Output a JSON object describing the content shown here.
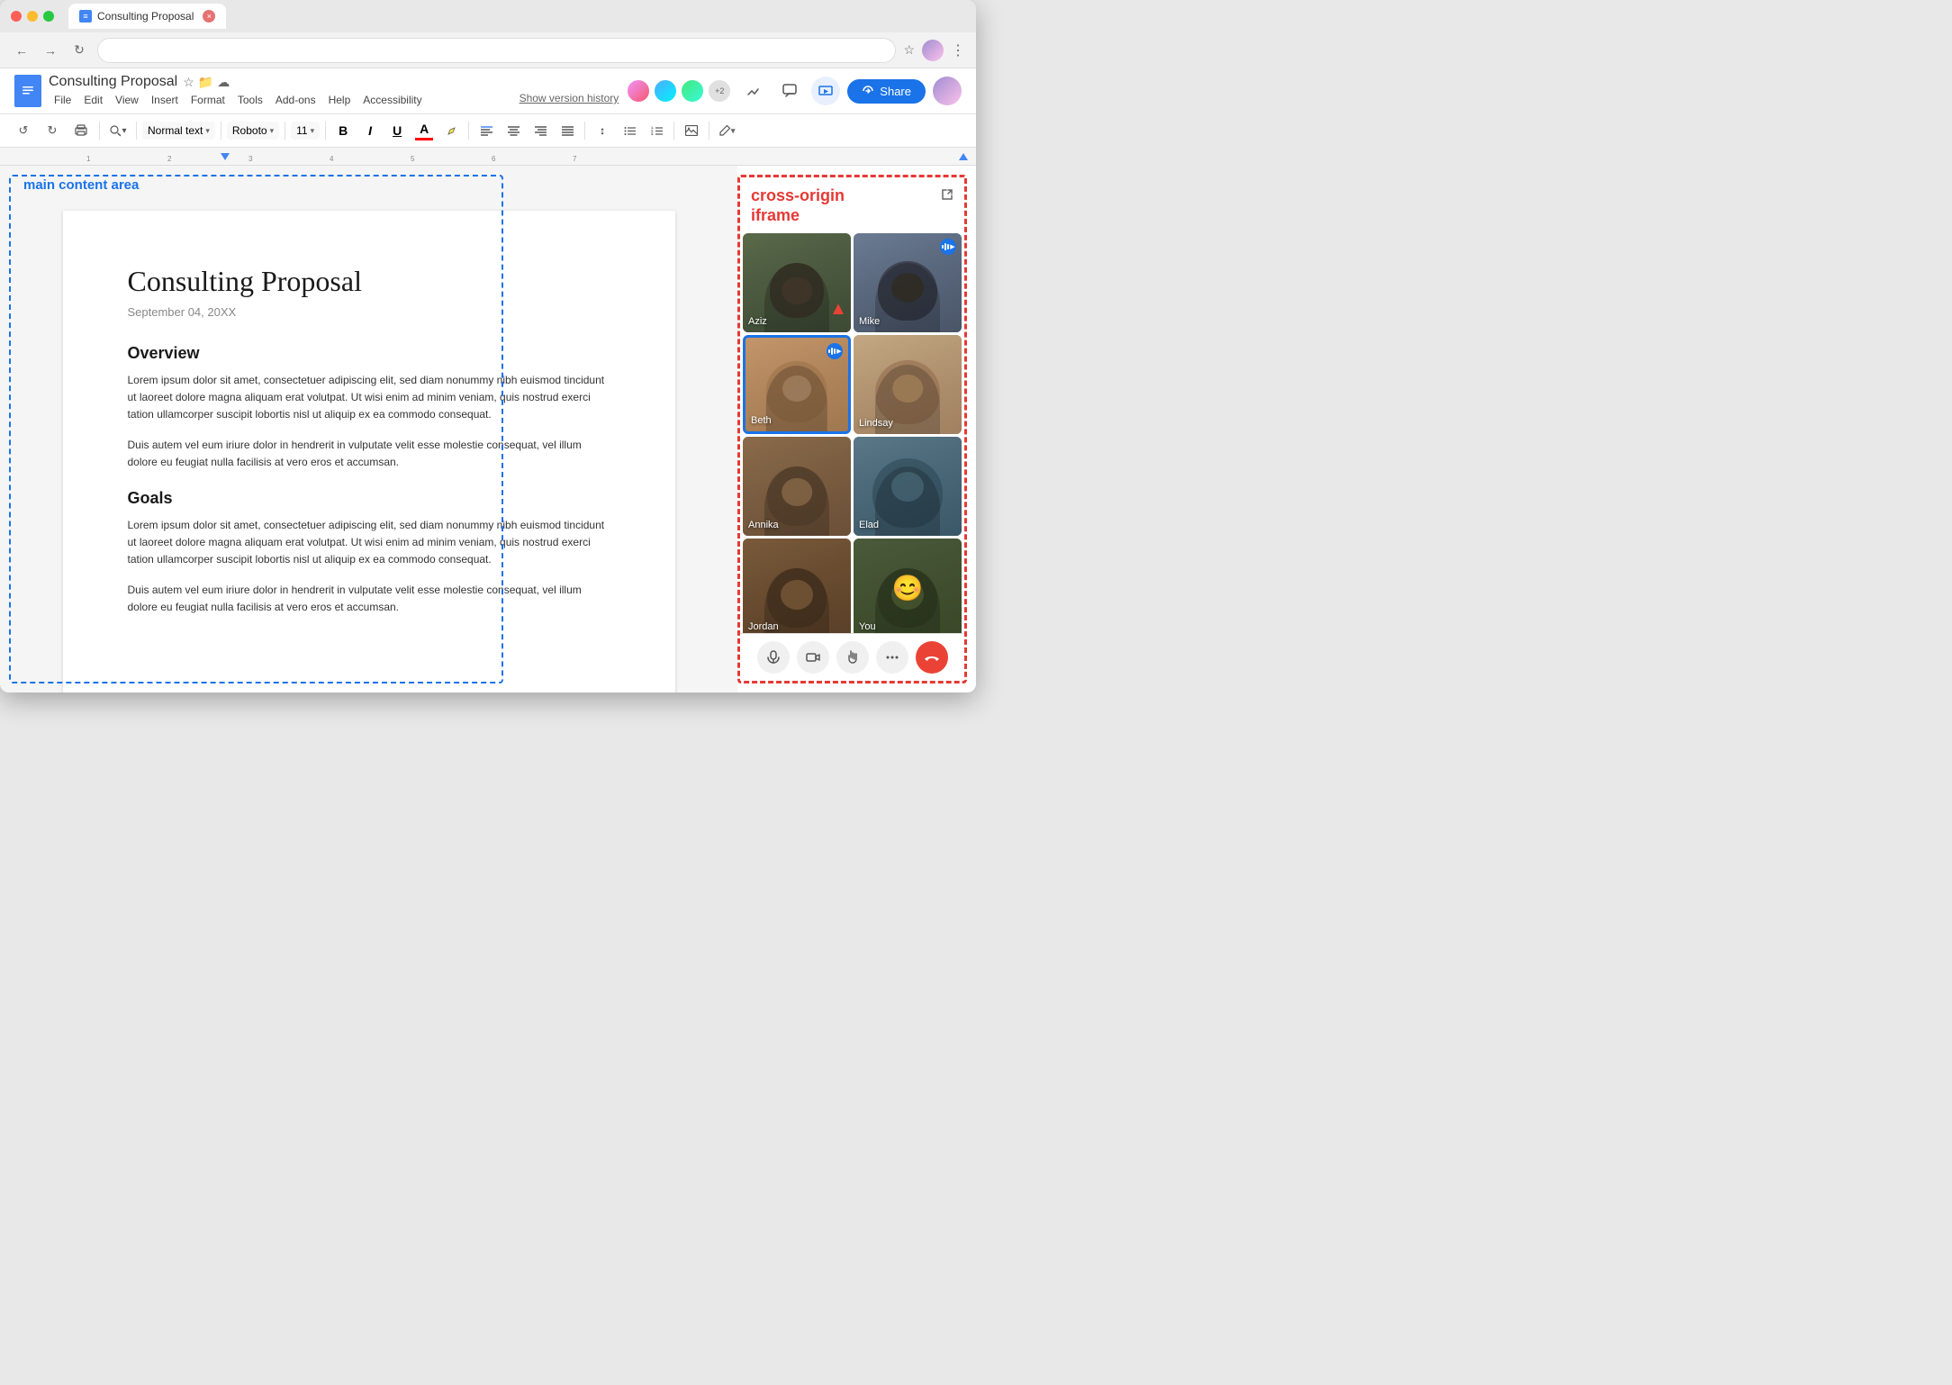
{
  "browser": {
    "tab_title": "Consulting Proposal",
    "back_btn": "←",
    "forward_btn": "→",
    "refresh_btn": "↻",
    "star_label": "☆",
    "more_options": "⋮"
  },
  "docs": {
    "logo_letter": "≡",
    "title": "Consulting Proposal",
    "version_history": "Show version history",
    "menu_items": [
      "File",
      "Edit",
      "View",
      "Insert",
      "Format",
      "Tools",
      "Add-ons",
      "Help",
      "Accessibility"
    ],
    "toolbar": {
      "undo": "↺",
      "redo": "↻",
      "print": "🖨",
      "zoom_label": "🔍",
      "normal_text": "Normal text",
      "font": "Roboto",
      "font_size": "11",
      "bold": "B",
      "italic": "I",
      "underline": "U",
      "text_color": "A",
      "highlight": "A",
      "align_left": "≡",
      "align_center": "≡",
      "align_right": "≡",
      "justify": "≡",
      "line_spacing": "↕",
      "bullets": "≡",
      "numbered": "≡",
      "insert_image": "⊡",
      "edit_pen": "✏"
    },
    "share_btn": "Share",
    "page": {
      "title": "Consulting Proposal",
      "date": "September 04, 20XX",
      "sections": [
        {
          "heading": "Overview",
          "paragraphs": [
            "Lorem ipsum dolor sit amet, consectetuer adipiscing elit, sed diam nonummy nibh euismod tincidunt ut laoreet dolore magna aliquam erat volutpat. Ut wisi enim ad minim veniam, quis nostrud exerci tation ullamcorper suscipit lobortis nisl ut aliquip ex ea commodo consequat.",
            "Duis autem vel eum iriure dolor in hendrerit in vulputate velit esse molestie consequat, vel illum dolore eu feugiat nulla facilisis at vero eros et accumsan."
          ]
        },
        {
          "heading": "Goals",
          "paragraphs": [
            "Lorem ipsum dolor sit amet, consectetuer adipiscing elit, sed diam nonummy nibh euismod tincidunt ut laoreet dolore magna aliquam erat volutpat. Ut wisi enim ad minim veniam, quis nostrud exerci tation ullamcorper suscipit lobortis nisl ut aliquip ex ea commodo consequat.",
            "Duis autem vel eum iriure dolor in hendrerit in vulputate velit esse molestie consequat, vel illum dolore eu feugiat nulla facilisis at vero eros et accumsan."
          ]
        }
      ]
    }
  },
  "cross_origin_iframe": {
    "title": "cross-origin\niframe",
    "participants": [
      {
        "name": "Aziz",
        "speaking": false,
        "active": false
      },
      {
        "name": "Mike",
        "speaking": true,
        "active": false
      },
      {
        "name": "Beth",
        "speaking": true,
        "active": true
      },
      {
        "name": "Lindsay",
        "speaking": false,
        "active": false
      },
      {
        "name": "Annika",
        "speaking": false,
        "active": false
      },
      {
        "name": "Elad",
        "speaking": false,
        "active": false
      },
      {
        "name": "Jordan",
        "speaking": false,
        "active": false
      },
      {
        "name": "You",
        "speaking": false,
        "active": false,
        "emoji": "😊"
      }
    ],
    "controls": {
      "mic": "🎤",
      "camera": "📷",
      "hand": "✋",
      "more": "⋮",
      "end_call": "📵"
    }
  },
  "main_content_label": "main content area",
  "format_menu": "Format",
  "normal_text_label": "Normal text"
}
